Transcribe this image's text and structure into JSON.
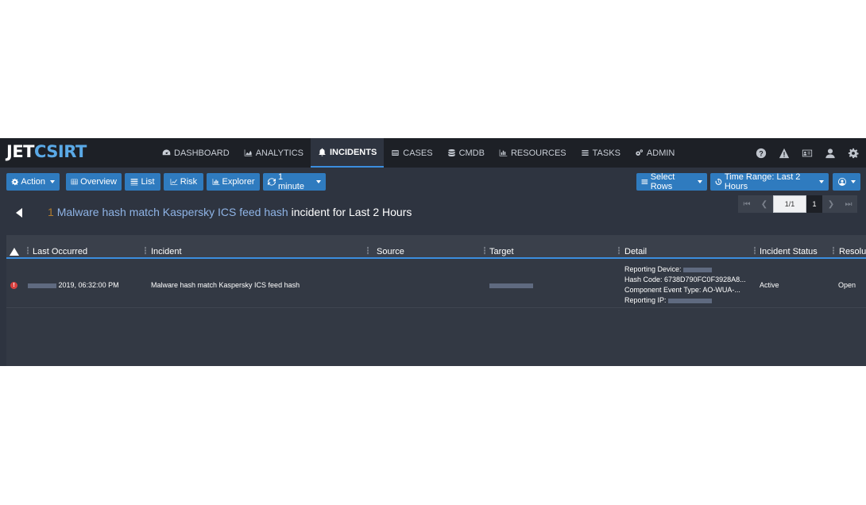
{
  "brand": {
    "part1": "JET",
    "part2": "CSIRT"
  },
  "nav": {
    "items": [
      {
        "label": "DASHBOARD",
        "icon": "dashboard-icon"
      },
      {
        "label": "ANALYTICS",
        "icon": "area-chart-icon"
      },
      {
        "label": "INCIDENTS",
        "icon": "bell-icon",
        "active": true
      },
      {
        "label": "CASES",
        "icon": "cases-icon"
      },
      {
        "label": "CMDB",
        "icon": "database-icon"
      },
      {
        "label": "RESOURCES",
        "icon": "bar-chart-icon"
      },
      {
        "label": "TASKS",
        "icon": "tasks-icon"
      },
      {
        "label": "ADMIN",
        "icon": "cogs-icon"
      }
    ],
    "right_icons": [
      "help-icon",
      "warning-icon",
      "id-card-icon",
      "user-icon",
      "gear-icon"
    ]
  },
  "toolbar": {
    "action": "Action",
    "overview": "Overview",
    "list": "List",
    "risk": "Risk",
    "explorer": "Explorer",
    "refresh": "1 minute",
    "select_rows": "Select Rows",
    "time_range": "Time Range: Last 2 Hours"
  },
  "heading": {
    "count": "1",
    "incident_name": "Malware hash match Kaspersky ICS feed hash",
    "suffix": "incident for Last 2 Hours"
  },
  "pager": {
    "page_value": "1/1",
    "page_number": "1"
  },
  "table": {
    "columns": [
      "Last Occurred",
      "Incident",
      "Source",
      "Target",
      "Detail",
      "Incident Status",
      "Resolu"
    ],
    "rows": [
      {
        "last_occurred": "2019, 06:32:00 PM",
        "incident": "Malware hash match Kaspersky ICS feed hash",
        "source": "",
        "detail": {
          "reporting_device": "Reporting Device:",
          "hash_code": "Hash Code: 6738D790FC0F3928A8...",
          "component_event_type": "Component Event Type: AO-WUA-...",
          "reporting_ip": "Reporting IP:"
        },
        "status": "Active",
        "resolution": "Open"
      }
    ]
  },
  "colors": {
    "accent": "#2f7bbf",
    "background": "#2e3440",
    "navbar": "#1d2026",
    "error": "#d9413f"
  }
}
